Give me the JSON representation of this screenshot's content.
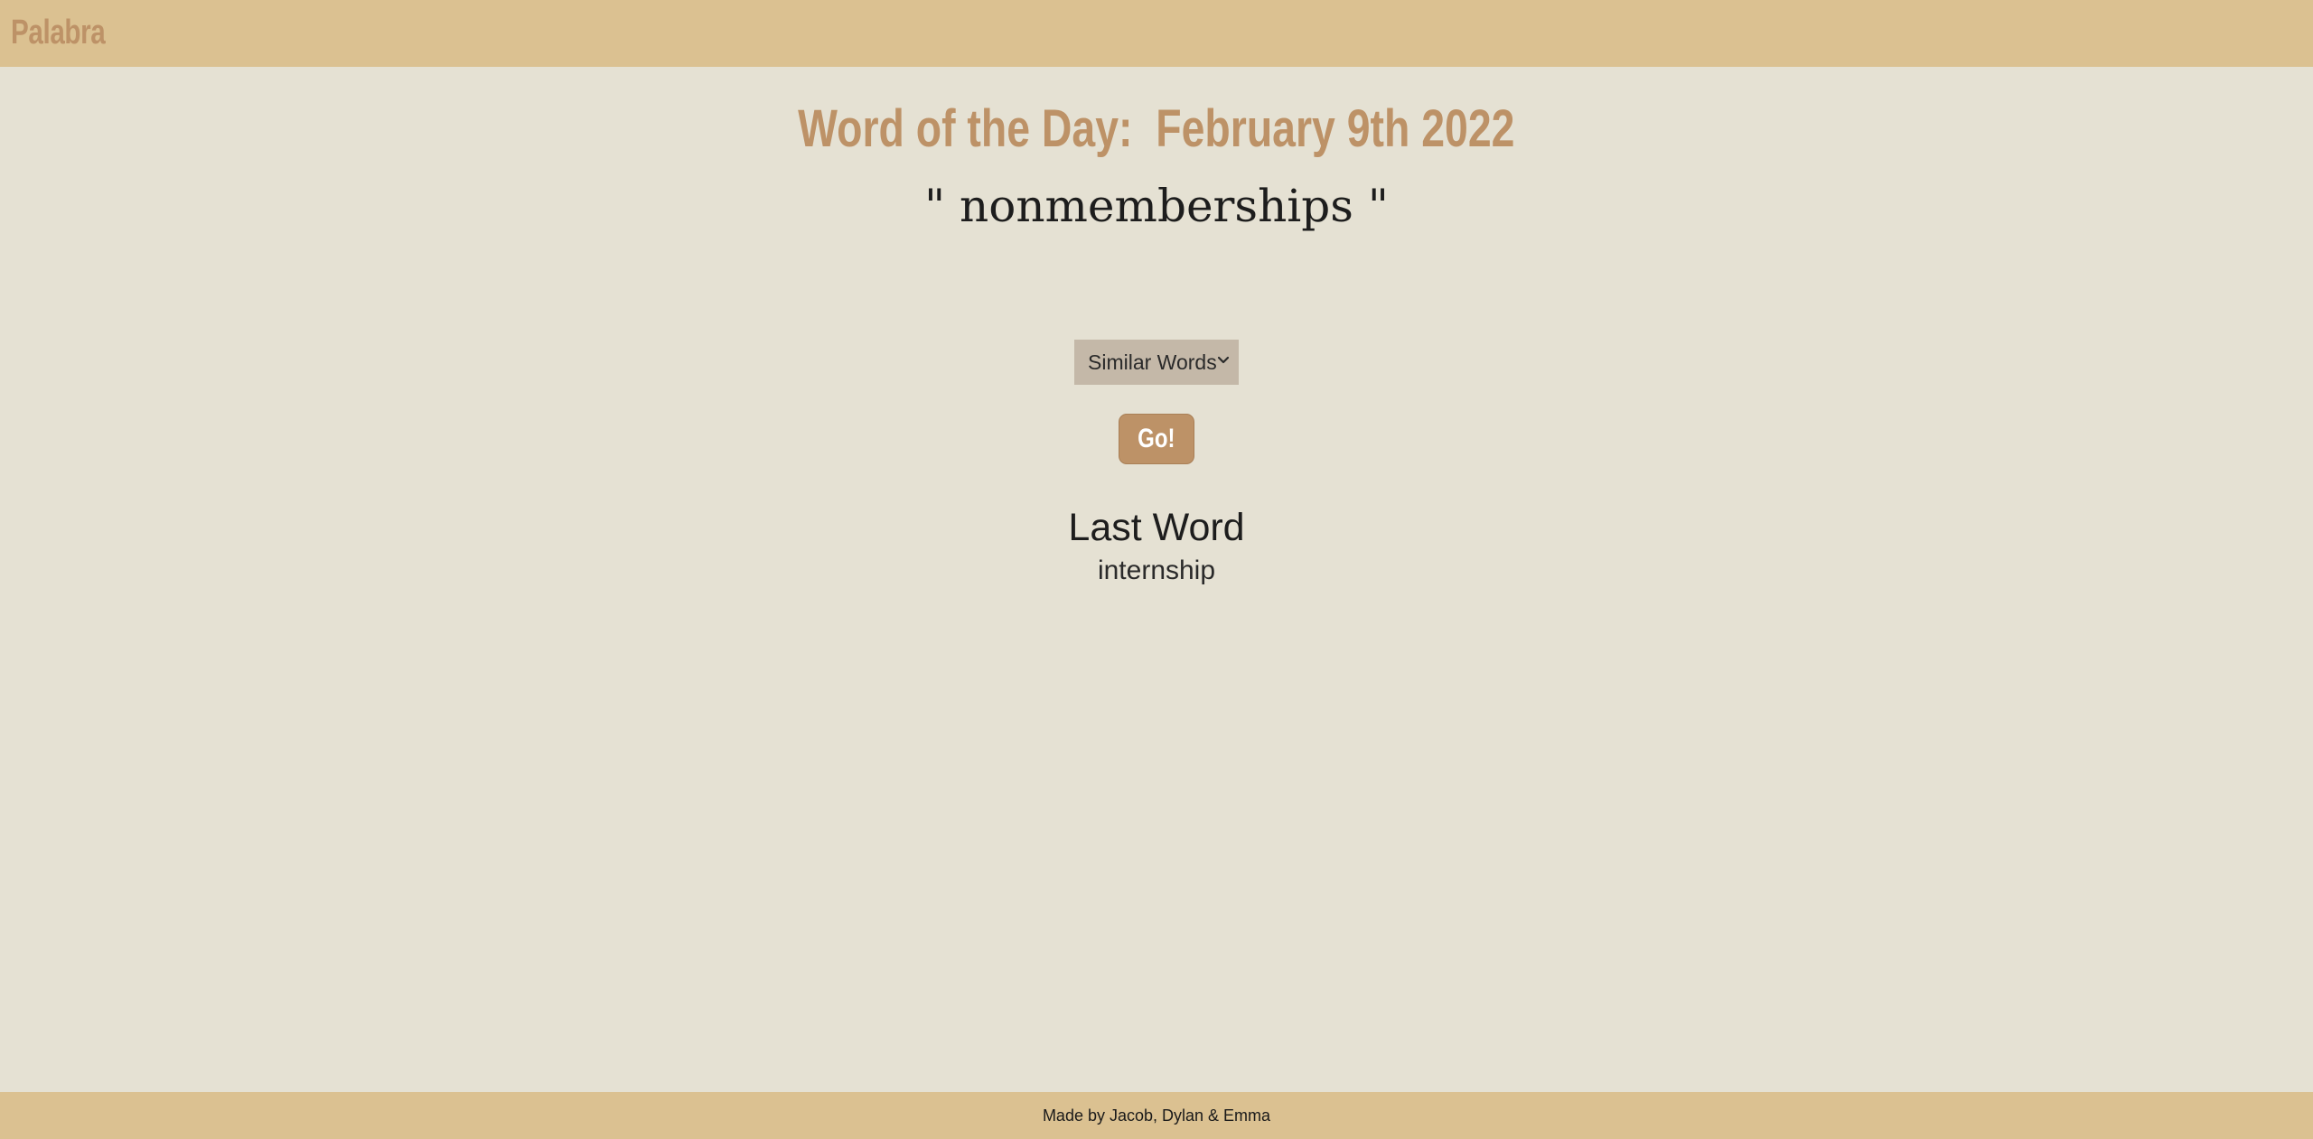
{
  "header": {
    "brand": "Palabra"
  },
  "main": {
    "headline": "Word of the Day:  February 9th 2022",
    "word": "\" nonmemberships \"",
    "select": {
      "selected": "Similar Words",
      "icon": "chevron-down-icon"
    },
    "go_label": "Go!",
    "last_word_title": "Last Word",
    "last_word_value": "internship"
  },
  "footer": {
    "credit": "Made by Jacob, Dylan & Emma"
  },
  "colors": {
    "bar": "#dbc191",
    "background": "#e5e1d3",
    "accent": "#bd9267",
    "select_bg": "#c4b8a8"
  }
}
